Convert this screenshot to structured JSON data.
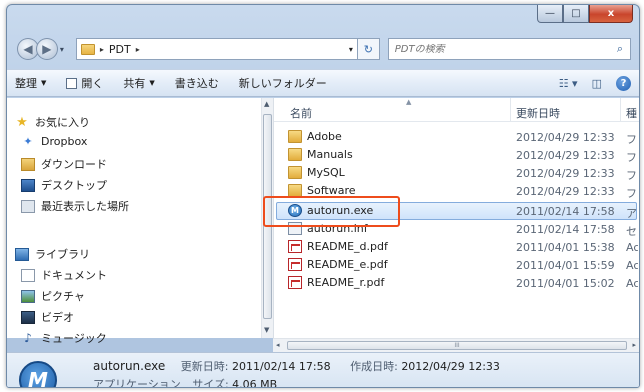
{
  "window": {
    "minimize": "—",
    "maximize": "□",
    "close": "x"
  },
  "nav": {
    "back": "◀",
    "forward": "▶",
    "dropdown": "▾"
  },
  "address": {
    "segment": "PDT",
    "sep1": "▸",
    "sep2": "▸",
    "dropdown": "▾",
    "refresh": "↻"
  },
  "search": {
    "placeholder": "PDTの検索",
    "icon": "⌕"
  },
  "toolbar": {
    "organize": "整理",
    "open": "開く",
    "share": "共有",
    "burn": "書き込む",
    "new_folder": "新しいフォルダー",
    "views": "☷ ▾",
    "preview_pane": "◫",
    "help": "?"
  },
  "sidebar": {
    "favorites_header": "お気に入り",
    "favorites": [
      {
        "label": "Dropbox",
        "icon": "dropbox-icon"
      },
      {
        "label": "ダウンロード",
        "icon": "downloads-icon"
      },
      {
        "label": "デスクトップ",
        "icon": "desktop-icon"
      },
      {
        "label": "最近表示した場所",
        "icon": "recent-places-icon"
      }
    ],
    "libraries_header": "ライブラリ",
    "libraries": [
      {
        "label": "ドキュメント",
        "icon": "documents-icon"
      },
      {
        "label": "ピクチャ",
        "icon": "pictures-icon"
      },
      {
        "label": "ビデオ",
        "icon": "videos-icon"
      },
      {
        "label": "ミュージック",
        "icon": "music-icon"
      }
    ]
  },
  "columns": {
    "name": "名前",
    "date": "更新日時",
    "type": "種"
  },
  "files": [
    {
      "name": "Adobe",
      "date": "2012/04/29 12:33",
      "type": "フ",
      "icon": "folder-icon"
    },
    {
      "name": "Manuals",
      "date": "2012/04/29 12:33",
      "type": "フ",
      "icon": "folder-icon"
    },
    {
      "name": "MySQL",
      "date": "2012/04/29 12:33",
      "type": "フ",
      "icon": "folder-icon"
    },
    {
      "name": "Software",
      "date": "2012/04/29 12:33",
      "type": "フ",
      "icon": "folder-icon"
    },
    {
      "name": "autorun.exe",
      "date": "2011/02/14 17:58",
      "type": "ア",
      "icon": "exe-icon",
      "selected": true
    },
    {
      "name": "autorun.inf",
      "date": "2011/02/14 17:58",
      "type": "セ",
      "icon": "inf-icon"
    },
    {
      "name": "README_d.pdf",
      "date": "2011/04/01 15:38",
      "type": "Ac",
      "icon": "pdf-icon"
    },
    {
      "name": "README_e.pdf",
      "date": "2011/04/01 15:59",
      "type": "Ac",
      "icon": "pdf-icon"
    },
    {
      "name": "README_r.pdf",
      "date": "2011/04/01 15:02",
      "type": "Ac",
      "icon": "pdf-icon"
    }
  ],
  "hscroll": {
    "left": "◂",
    "right": "▸",
    "grip": "III"
  },
  "vscroll": {
    "up": "▲",
    "down": "▼"
  },
  "details": {
    "filename": "autorun.exe",
    "modified_label": "更新日時:",
    "modified_value": "2011/02/14 17:58",
    "created_label": "作成日時:",
    "created_value": "2012/04/29 12:33",
    "type": "アプリケーション",
    "size_label": "サイズ:",
    "size_value": "4.06 MB",
    "icon": "autorun-app-icon"
  },
  "colors": {
    "highlight_outline": "#ee4c1c",
    "selection": "#cfe3fb"
  }
}
